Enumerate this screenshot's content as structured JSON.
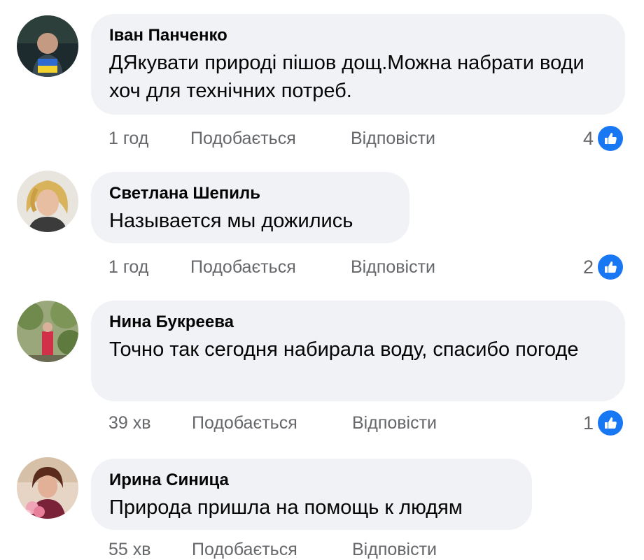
{
  "actions": {
    "like_label": "Подобається",
    "reply_label": "Відповісти"
  },
  "comments": [
    {
      "author": "Іван Панченко",
      "text": "ДЯкувати природі пішов дощ.Можна набрати води хоч для технічних потреб.",
      "time": "1 год",
      "likes": "4"
    },
    {
      "author": "Светлана Шепиль",
      "text": "Называется мы дожились",
      "time": "1 год",
      "likes": "2"
    },
    {
      "author": "Нина Букреева",
      "text": "Точно так сегодня набирала воду, спасибо погоде",
      "time": "39 хв",
      "likes": "1"
    },
    {
      "author": "Ирина Синица",
      "text": "Природа пришла на помощь к людям",
      "time": "55 хв",
      "likes": ""
    }
  ],
  "colors": {
    "bubble": "#f0f2f5",
    "meta_text": "#65676b",
    "like_blue": "#1877f2"
  }
}
